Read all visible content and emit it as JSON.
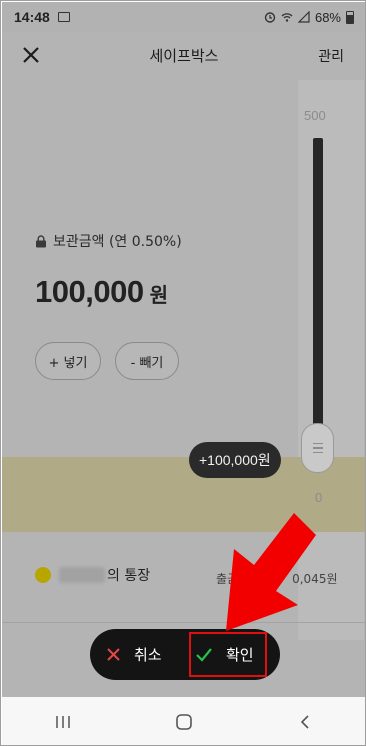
{
  "status_bar": {
    "time": "14:48",
    "battery": "68%"
  },
  "header": {
    "title": "세이프박스",
    "manage_label": "관리"
  },
  "safebox": {
    "info_label": "보관금액 (연 0.50%)",
    "amount": "100,000",
    "unit": "원"
  },
  "buttons": {
    "put": "+ 넣기",
    "take": "- 빼기"
  },
  "slider": {
    "max_label": "500",
    "min_label": "0",
    "value_bubble": "+100,000원"
  },
  "account": {
    "name_suffix": "의 통장",
    "withdraw_prefix": "출금",
    "balance": "0,045원"
  },
  "action_bar": {
    "cancel": "취소",
    "confirm": "확인"
  },
  "colors": {
    "highlight": "#e01010",
    "confirm_check": "#27c24c",
    "cancel_x": "#e84545",
    "account_dot": "#b8a600"
  }
}
